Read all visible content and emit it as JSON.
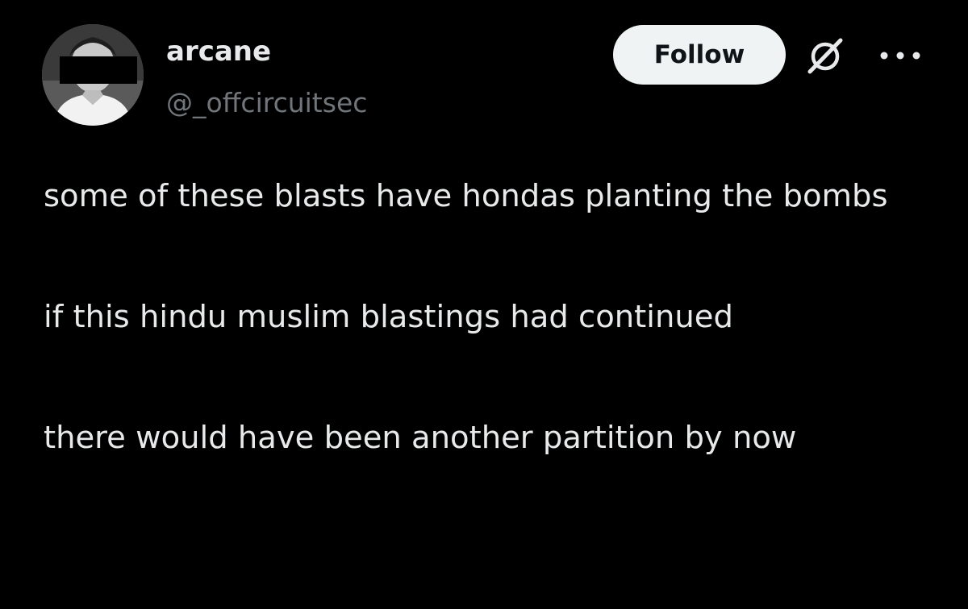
{
  "post": {
    "author": {
      "display_name": "arcane",
      "handle": "@_offcircuitsec",
      "avatar": "avatar-photo"
    },
    "actions": {
      "follow_label": "Follow",
      "grok_icon": "grok-icon",
      "more_icon": "more-options-icon"
    },
    "body": {
      "paragraphs": [
        "some of these blasts have hondas planting the bombs",
        "if this hindu muslim blastings had continued",
        "there would have been another partition by now"
      ]
    }
  },
  "colors": {
    "background": "#000000",
    "text_primary": "#e7e9ea",
    "text_secondary": "#71767b",
    "follow_bg": "#eff3f4",
    "follow_text": "#0f1419"
  }
}
